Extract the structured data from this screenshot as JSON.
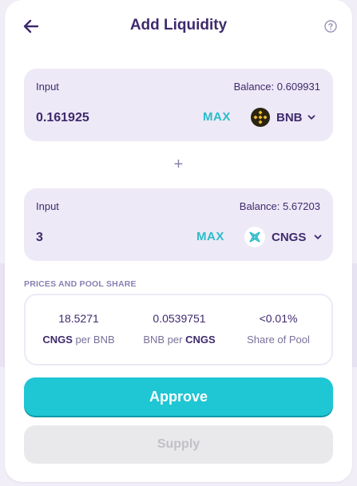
{
  "header": {
    "title": "Add Liquidity",
    "back_icon": "arrow-left-icon",
    "help_icon": "question-circle-icon"
  },
  "input_a": {
    "label": "Input",
    "balance": "Balance: 0.609931",
    "value": "0.161925",
    "max_label": "MAX",
    "token": "BNB",
    "token_icon": "bnb-icon"
  },
  "plus": "+",
  "input_b": {
    "label": "Input",
    "balance": "Balance: 5.67203",
    "value": "3",
    "max_label": "MAX",
    "token": "CNGS",
    "token_icon": "cngs-icon"
  },
  "pool": {
    "title": "PRICES AND POOL SHARE",
    "col1": {
      "value": "18.5271",
      "base": "CNGS",
      "rest": " per BNB"
    },
    "col2": {
      "value": "0.0539751",
      "pre": "BNB per ",
      "quote": "CNGS"
    },
    "col3": {
      "value": "<0.01%",
      "label": "Share of Pool"
    }
  },
  "actions": {
    "approve": "Approve",
    "supply": "Supply"
  },
  "colors": {
    "accent": "#1fc6d3",
    "text": "#3f2a6e",
    "panel": "#ede9f6",
    "bnb": "#f3ba2f"
  }
}
